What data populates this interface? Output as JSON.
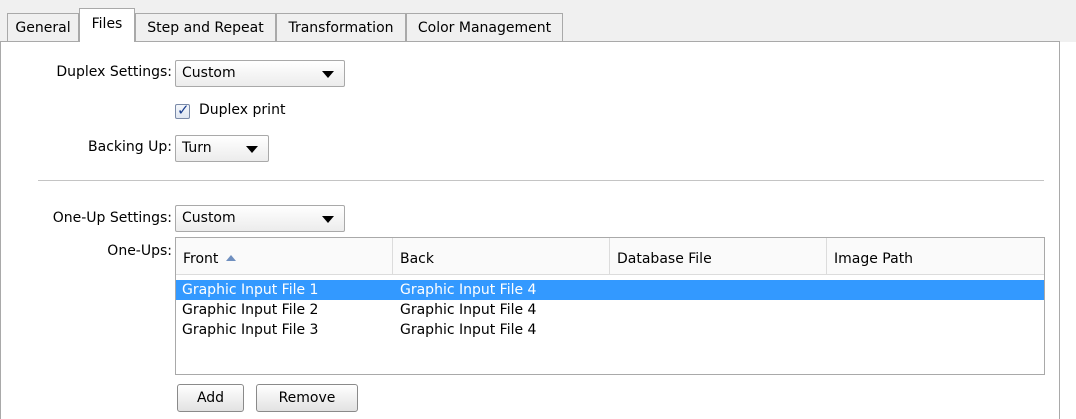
{
  "tabs": [
    {
      "label": "General"
    },
    {
      "label": "Files"
    },
    {
      "label": "Step and Repeat"
    },
    {
      "label": "Transformation"
    },
    {
      "label": "Color Management"
    }
  ],
  "duplex": {
    "label": "Duplex Settings:",
    "value": "Custom",
    "checkbox_label": "Duplex print",
    "checked": true
  },
  "backing": {
    "label": "Backing Up:",
    "value": "Turn"
  },
  "oneup": {
    "label": "One-Up Settings:",
    "value": "Custom",
    "list_label": "One-Ups:",
    "columns": [
      "Front",
      "Back",
      "Database File",
      "Image Path"
    ],
    "rows": [
      {
        "front": "Graphic Input File 1",
        "back": "Graphic Input File 4",
        "db": "",
        "path": ""
      },
      {
        "front": "Graphic Input File 2",
        "back": "Graphic Input File 4",
        "db": "",
        "path": ""
      },
      {
        "front": "Graphic Input File 3",
        "back": "Graphic Input File 4",
        "db": "",
        "path": ""
      }
    ],
    "selected_row": 0
  },
  "buttons": {
    "add": "Add",
    "remove": "Remove"
  },
  "colors": {
    "selection": "#3399ff",
    "sort_arrow": "#6f8fbf"
  }
}
